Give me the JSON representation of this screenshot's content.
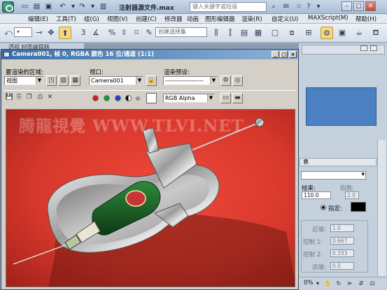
{
  "app": {
    "doc_title": "注射器源文件.max",
    "search_placeholder": "键入关键字或短语"
  },
  "menu": [
    {
      "label": "编辑(E)"
    },
    {
      "label": "工具(T)"
    },
    {
      "label": "组(G)"
    },
    {
      "label": "视图(V)"
    },
    {
      "label": "创建(C)"
    },
    {
      "label": "修改器"
    },
    {
      "label": "动画"
    },
    {
      "label": "图形编辑器"
    },
    {
      "label": "渲染(R)"
    },
    {
      "label": "自定义(U)"
    },
    {
      "label": "MAXScript(M)"
    },
    {
      "label": "帮助(H)"
    }
  ],
  "toolbar": {
    "selection_set_placeholder": "创建选择集"
  },
  "side_tab_partial": "透视 材质编辑器",
  "render_window": {
    "title": "Camera001, 帧 0, RGBA 颜色 16 位/通道 (1:1)",
    "area_label": "要渲染的区域:",
    "area_value": "视图",
    "viewport_label": "视口:",
    "viewport_value": "Camera001",
    "preset_label": "渲染预设:",
    "preset_value": "-------------------",
    "channel_value": "RGB Alpha",
    "watermark": "腾龍視覺 WWW.TLVI.NET"
  },
  "command_panel": {
    "rollout_partial": "袁",
    "end_label": "结束:",
    "end_value": "110.0",
    "index_label": "指数:",
    "index_value": "2.0",
    "specify_label": "指定:",
    "near_label": "近端:",
    "near_value": "1.0",
    "ctrl1_label": "控制 1:",
    "ctrl1_value": "0.667",
    "ctrl2_label": "控制 2:",
    "ctrl2_value": "0.333",
    "far_label": "远端:",
    "far_value": "0.0",
    "zoom_partial": "0%"
  },
  "colors": {
    "render_bg": "#d7382c",
    "window_title": "#3a6ea5",
    "panel_blue": "#4b80c2"
  }
}
